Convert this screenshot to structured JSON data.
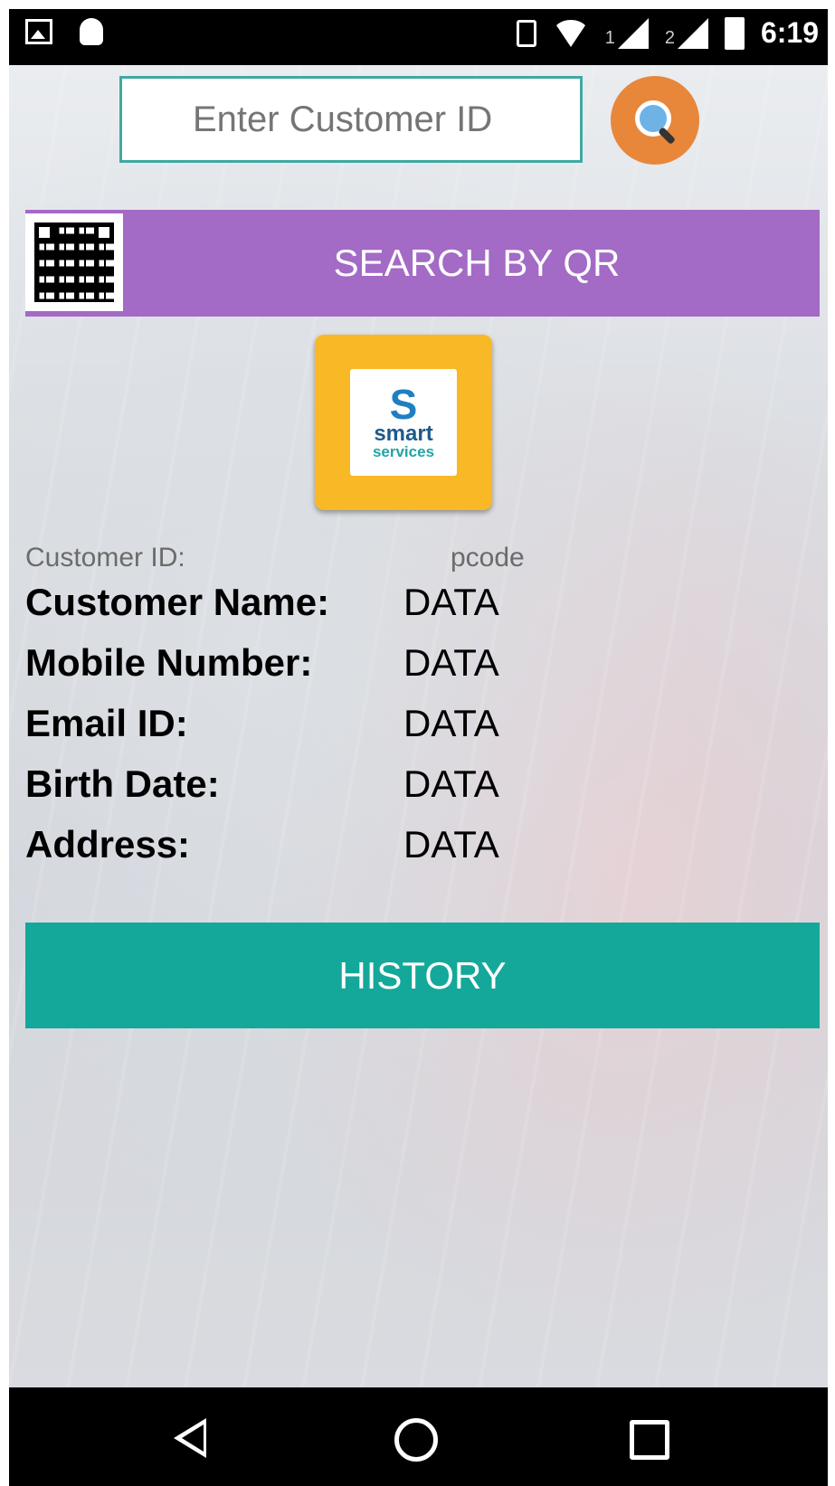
{
  "status_bar": {
    "time": "6:19",
    "sim1_label": "1",
    "sim2_label": "2",
    "icons": [
      "image-icon",
      "android-icon",
      "vibrate-icon",
      "wifi-icon",
      "signal-icon",
      "battery-icon"
    ]
  },
  "search": {
    "placeholder": "Enter Customer ID",
    "value": ""
  },
  "qr_button": {
    "label": "SEARCH BY QR"
  },
  "logo": {
    "mark": "S",
    "name_line1": "smart",
    "name_line2": "services"
  },
  "customer": {
    "id_label": "Customer ID:",
    "id_value": "pcode",
    "fields": [
      {
        "label": "Customer Name:",
        "value": "DATA"
      },
      {
        "label": "Mobile Number:",
        "value": "DATA"
      },
      {
        "label": "Email ID:",
        "value": "DATA"
      },
      {
        "label": "Birth Date:",
        "value": "DATA"
      },
      {
        "label": "Address:",
        "value": "DATA"
      }
    ]
  },
  "history_button": {
    "label": "HISTORY"
  },
  "colors": {
    "qr_bar": "#a36ac6",
    "history_bar": "#14a89a",
    "search_button": "#e8863a",
    "logo_tile": "#f9b825"
  }
}
